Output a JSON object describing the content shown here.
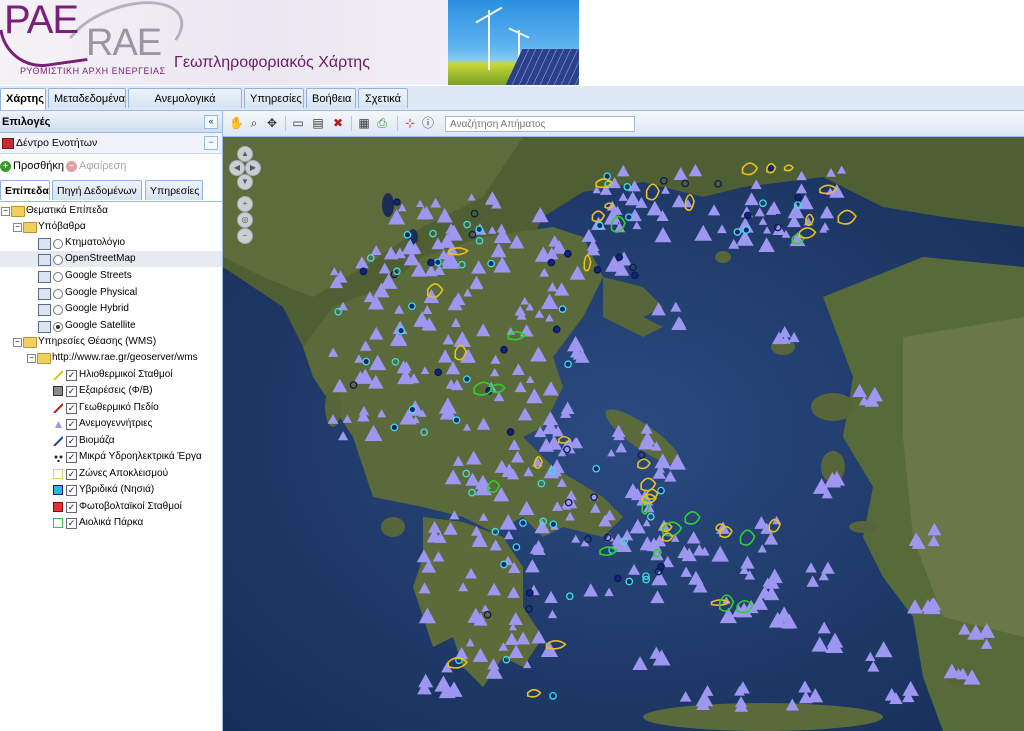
{
  "header": {
    "logo_pae": "PAE",
    "logo_rae": "RAE",
    "org_name": "ΡΥΘΜΙΣΤΙΚΗ ΑΡΧΗ ΕΝΕΡΓΕΙΑΣ",
    "title": "Γεωπληροφοριακός Χάρτης"
  },
  "tabs": [
    {
      "label": "Χάρτης",
      "active": true
    },
    {
      "label": "Μεταδεδομένα"
    },
    {
      "label": "Ανεμολογικά Δεδομένα"
    },
    {
      "label": "Υπηρεσίες"
    },
    {
      "label": "Βοήθεια"
    },
    {
      "label": "Σχετικά"
    }
  ],
  "left_panel": {
    "title": "Επιλογές",
    "tree_title": "Δέντρο Ενοτήτων",
    "add_label": "Προσθήκη",
    "remove_label": "Αφαίρεση",
    "subtabs": [
      "Επίπεδα",
      "Πηγή Δεδομένων",
      "Υπηρεσίες"
    ],
    "tree": {
      "root": "Θεματικά Επίπεδα",
      "basemaps_folder": "Υπόβαθρα",
      "basemaps": [
        {
          "label": "Κτηματολόγιο",
          "selected": false
        },
        {
          "label": "OpenStreetMap",
          "selected": false
        },
        {
          "label": "Google Streets",
          "selected": false
        },
        {
          "label": "Google Physical",
          "selected": false
        },
        {
          "label": "Google Hybrid",
          "selected": false
        },
        {
          "label": "Google Satellite",
          "selected": true
        }
      ],
      "wms_folder": "Υπηρεσίες Θέασης (WMS)",
      "wms_url": "http://www.rae.gr/geoserver/wms",
      "layers": [
        {
          "label": "Ηλιοθερμικοί Σταθμοί",
          "checked": true,
          "legend": "line-yellow"
        },
        {
          "label": "Εξαιρέσεις (Φ/Β)",
          "checked": true,
          "legend": "box-gray"
        },
        {
          "label": "Γεωθερμικό Πεδίο",
          "checked": true,
          "legend": "line-red"
        },
        {
          "label": "Ανεμογεννήτριες",
          "checked": true,
          "legend": "triangle-lavender"
        },
        {
          "label": "Βιομάζα",
          "checked": true,
          "legend": "line-blue"
        },
        {
          "label": "Μικρά Υδροηλεκτρικά Έργα",
          "checked": true,
          "legend": "dots-dark"
        },
        {
          "label": "Ζώνες Αποκλεισμού",
          "checked": true,
          "legend": "box-yellow"
        },
        {
          "label": "Υβριδικά (Νησιά)",
          "checked": true,
          "legend": "box-cyan"
        },
        {
          "label": "Φωτοβολταϊκοί Σταθμοί",
          "checked": true,
          "legend": "box-red"
        },
        {
          "label": "Αιολικά Πάρκα",
          "checked": true,
          "legend": "box-green"
        }
      ]
    }
  },
  "map": {
    "search_placeholder": "Αναζήτηση Απήματος",
    "colors": {
      "sea": "#1f3a6a",
      "land": "#5a6b3a",
      "wind_turbines": "#9d97f2",
      "small_hydro": "#12247a",
      "exclusion_zones": "#e8c020",
      "wind_parks": "#30d030"
    },
    "basemap": "Google Satellite"
  }
}
